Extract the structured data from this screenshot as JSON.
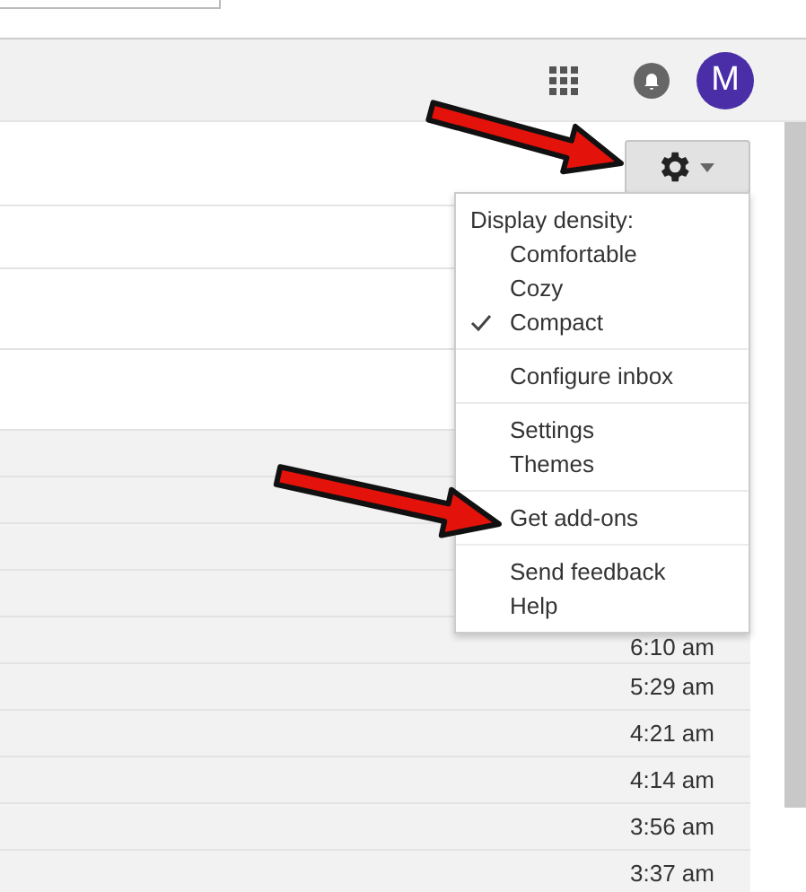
{
  "header": {
    "avatar_letter": "M"
  },
  "rows": [
    {
      "read": false
    },
    {
      "read": false
    },
    {
      "read": false
    },
    {
      "read": true
    },
    {
      "read": true
    },
    {
      "read": true
    },
    {
      "read": true
    },
    {
      "read": true,
      "time": "6:10 am"
    },
    {
      "read": true,
      "time": "5:29 am"
    },
    {
      "read": true,
      "time": "4:21 am"
    },
    {
      "read": true,
      "time": "4:14 am"
    },
    {
      "read": true,
      "time": "3:56 am"
    },
    {
      "read": true,
      "time": "3:37 am"
    }
  ],
  "settings_menu": {
    "open": true,
    "sections": [
      {
        "heading": "Display density:",
        "items": [
          {
            "label": "Comfortable",
            "checked": false
          },
          {
            "label": "Cozy",
            "checked": false
          },
          {
            "label": "Compact",
            "checked": true
          }
        ]
      },
      {
        "items": [
          {
            "label": "Configure inbox"
          }
        ]
      },
      {
        "items": [
          {
            "label": "Settings"
          },
          {
            "label": "Themes"
          }
        ]
      },
      {
        "items": [
          {
            "label": "Get add-ons"
          }
        ]
      },
      {
        "items": [
          {
            "label": "Send feedback"
          },
          {
            "label": "Help"
          }
        ]
      }
    ]
  },
  "annotations": [
    {
      "kind": "arrow"
    },
    {
      "kind": "arrow"
    }
  ]
}
